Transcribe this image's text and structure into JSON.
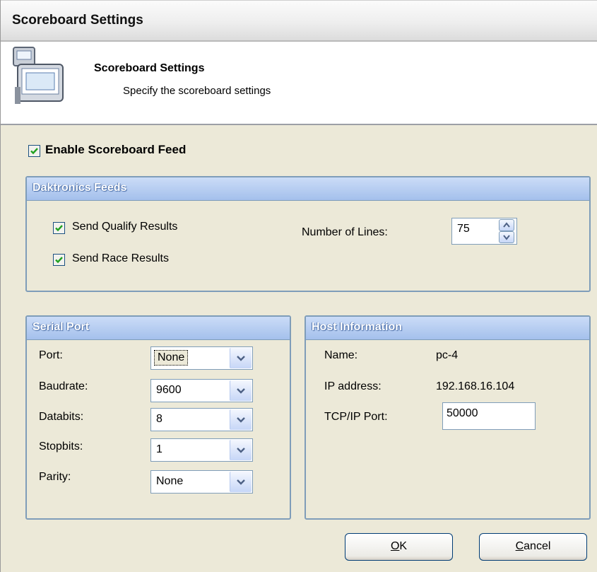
{
  "window": {
    "title": "Scoreboard Settings"
  },
  "header": {
    "icon": "settings-window-icon",
    "title": "Scoreboard Settings",
    "subtitle": "Specify the scoreboard settings"
  },
  "enable_feed": {
    "label": "Enable Scoreboard Feed",
    "checked": true
  },
  "daktronics": {
    "title": "Daktronics Feeds",
    "send_qualify": {
      "label": "Send Qualify Results",
      "checked": true
    },
    "send_race": {
      "label": "Send Race Results",
      "checked": true
    },
    "lines_label": "Number of Lines:",
    "lines_value": "75"
  },
  "serial": {
    "title": "Serial Port",
    "fields": [
      {
        "label": "Port:",
        "value": "None"
      },
      {
        "label": "Baudrate:",
        "value": "9600"
      },
      {
        "label": "Databits:",
        "value": "8"
      },
      {
        "label": "Stopbits:",
        "value": "1"
      },
      {
        "label": "Parity:",
        "value": "None"
      }
    ]
  },
  "host": {
    "title": "Host Information",
    "name_label": "Name:",
    "name_value": "pc-4",
    "ip_label": "IP address:",
    "ip_value": "192.168.16.104",
    "port_label": "TCP/IP Port:",
    "port_value": "50000"
  },
  "buttons": {
    "ok_mnemonic": "O",
    "ok_rest": "K",
    "cancel_mnemonic": "C",
    "cancel_rest": "ancel"
  },
  "colors": {
    "group_header": "#a4c0ec",
    "group_border": "#7f9db9",
    "dialog_bg": "#ece9d8",
    "check_green": "#21a121"
  }
}
